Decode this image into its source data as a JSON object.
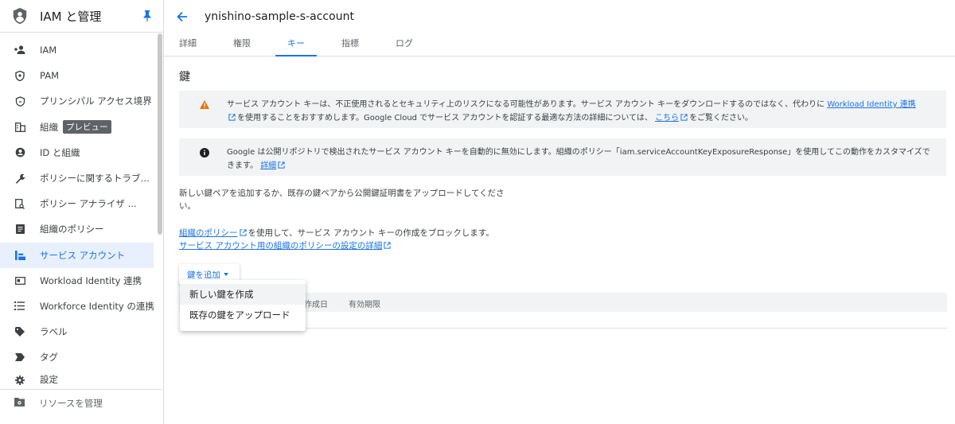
{
  "sidebar": {
    "title": "IAM と管理",
    "items": [
      {
        "label": "IAM",
        "icon": "person-add-icon"
      },
      {
        "label": "PAM",
        "icon": "shield-icon"
      },
      {
        "label": "プリンシパル アクセス境界",
        "icon": "boundary-icon"
      },
      {
        "label": "組織",
        "icon": "organization-icon",
        "badge": "プレビュー"
      },
      {
        "label": "ID と組織",
        "icon": "account-circle-icon"
      },
      {
        "label": "ポリシーに関するトラブ…",
        "icon": "wrench-icon"
      },
      {
        "label": "ポリシー アナライザ ...",
        "icon": "policy-analyzer-icon"
      },
      {
        "label": "組織のポリシー",
        "icon": "document-icon"
      },
      {
        "label": "サービス アカウント",
        "icon": "service-account-icon",
        "active": true
      },
      {
        "label": "Workload Identity 連携",
        "icon": "id-card-icon"
      },
      {
        "label": "Workforce Identity の連携",
        "icon": "list-icon"
      },
      {
        "label": "ラベル",
        "icon": "label-icon"
      },
      {
        "label": "タグ",
        "icon": "tag-icon"
      },
      {
        "label": "設定",
        "icon": "gear-icon"
      }
    ],
    "footer": "リソースを管理"
  },
  "header": {
    "title": "ynishino-sample-s-account"
  },
  "tabs": [
    "詳細",
    "権限",
    "キー",
    "指標",
    "ログ"
  ],
  "active_tab": "キー",
  "section_title": "鍵",
  "warning": {
    "text1": "サービス アカウント キーは、不正使用されるとセキュリティ上のリスクになる可能性があります。サービス アカウント キーをダウンロードするのではなく、代わりに",
    "link1": "Workload Identity 連携",
    "text2": "を使用することをおすすめします。Google Cloud でサービス アカウントを認証する最適な方法の詳細については、",
    "link2": "こちら",
    "text3": "をご覧ください。"
  },
  "info": {
    "text1": "Google は公開リポジトリで検出されたサービス アカウント キーを自動的に無効にします。組織のポリシー「iam.serviceAccountKeyExposureResponse」を使用してこの動作をカスタマイズできます。",
    "link1": "詳細"
  },
  "description": "新しい鍵ペアを追加するか、既存の鍵ペアから公開鍵証明書をアップロードしてください。",
  "policy": {
    "link1": "組織のポリシー",
    "text1": "を使用して、サービス アカウント キーの作成をブロックします。",
    "link2": "サービス アカウント用の組織のポリシーの設定の詳細"
  },
  "add_key_button": "鍵を追加",
  "menu": [
    "新しい鍵を作成",
    "既存の鍵をアップロード"
  ],
  "table": {
    "columns": [
      "作成日",
      "有効期限"
    ]
  },
  "colors": {
    "accent": "#1a73e8",
    "warning": "#e37400",
    "banner_bg": "#f1f3f4"
  }
}
